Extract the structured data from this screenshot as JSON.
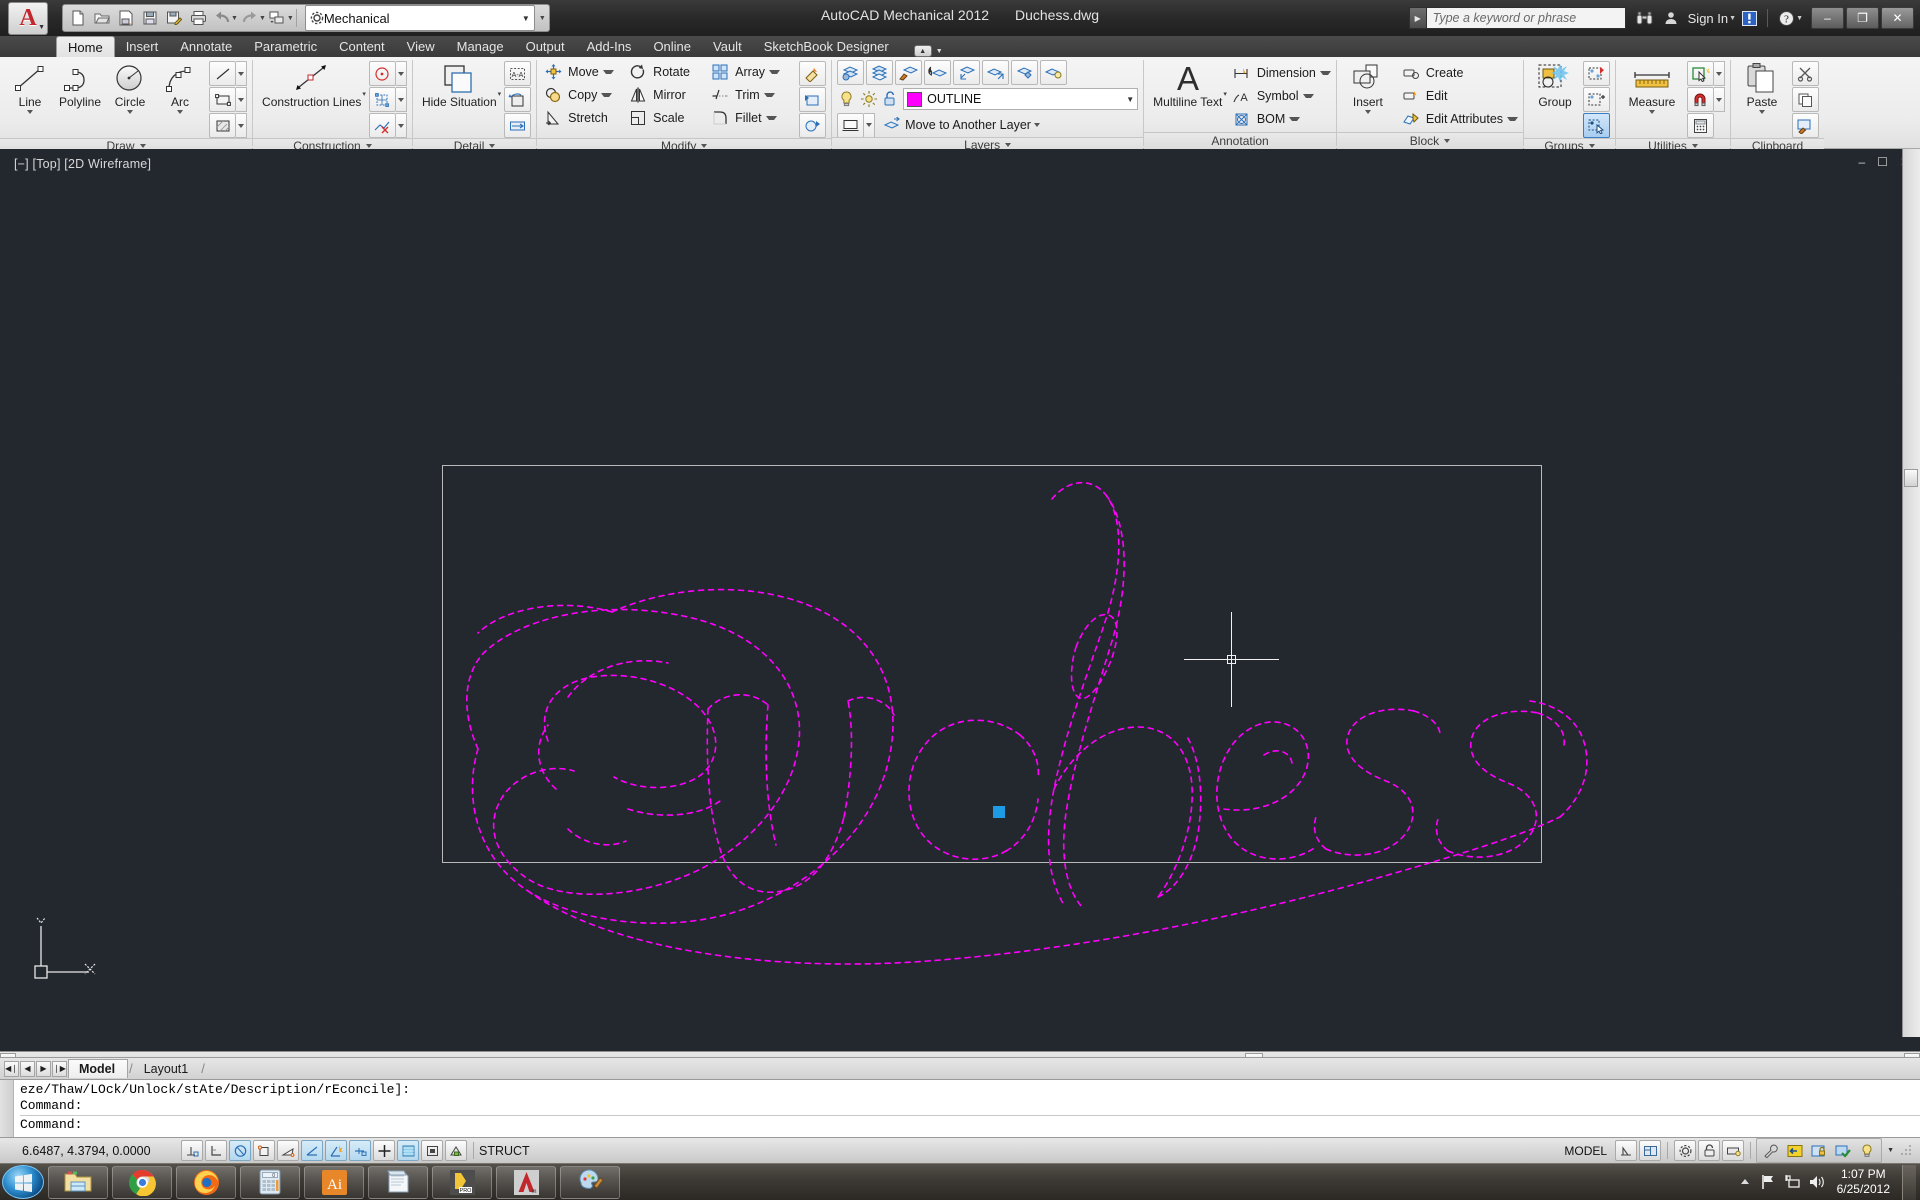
{
  "titlebar": {
    "app_logo": "autocad-logo",
    "workspace": "Mechanical",
    "app_title": "AutoCAD Mechanical 2012",
    "document": "Duchess.dwg",
    "search_placeholder": "Type a keyword or phrase",
    "sign_in": "Sign In",
    "quick_access": [
      {
        "name": "new-file",
        "icon": "page-icon"
      },
      {
        "name": "open-file",
        "icon": "folder-open-icon"
      },
      {
        "name": "save-as-dwg",
        "icon": "save-dwg-icon"
      },
      {
        "name": "save",
        "icon": "floppy-icon"
      },
      {
        "name": "save-edit",
        "icon": "floppy-pencil-icon"
      },
      {
        "name": "plot",
        "icon": "printer-icon"
      },
      {
        "name": "undo",
        "icon": "undo-arrow-icon"
      },
      {
        "name": "redo",
        "icon": "redo-arrow-icon"
      },
      {
        "name": "batch-plot",
        "icon": "stacked-pages-icon"
      }
    ],
    "window_buttons": {
      "minimize": "–",
      "maximize": "❐",
      "close": "✕"
    }
  },
  "tabs": [
    {
      "label": "Home",
      "active": true
    },
    {
      "label": "Insert",
      "active": false
    },
    {
      "label": "Annotate",
      "active": false
    },
    {
      "label": "Parametric",
      "active": false
    },
    {
      "label": "Content",
      "active": false
    },
    {
      "label": "View",
      "active": false
    },
    {
      "label": "Manage",
      "active": false
    },
    {
      "label": "Output",
      "active": false
    },
    {
      "label": "Add-Ins",
      "active": false
    },
    {
      "label": "Online",
      "active": false
    },
    {
      "label": "Vault",
      "active": false
    },
    {
      "label": "SketchBook Designer",
      "active": false
    }
  ],
  "ribbon": {
    "draw": {
      "title": "Draw",
      "big": [
        {
          "label": "Line",
          "icon": "line-icon",
          "dropdown": true
        },
        {
          "label": "Polyline",
          "icon": "polyline-icon",
          "dropdown": false
        },
        {
          "label": "Circle",
          "icon": "circle-icon",
          "dropdown": true
        },
        {
          "label": "Arc",
          "icon": "arc-icon",
          "dropdown": true
        }
      ],
      "small": [
        {
          "name": "construction-line-small",
          "icon": "diagonal-line-icon"
        },
        {
          "name": "rectangle",
          "icon": "rectangle-icon"
        },
        {
          "name": "hatch",
          "icon": "hatch-icon"
        }
      ]
    },
    "construction": {
      "title": "Construction",
      "big": [
        {
          "label": "Construction Lines",
          "icon": "double-arrow-icon",
          "dropdown": true
        }
      ],
      "small": [
        {
          "name": "construction-circle",
          "icon": "red-circle-icon"
        },
        {
          "name": "construction-grid",
          "icon": "blue-grid-icon"
        },
        {
          "name": "delete-construction",
          "icon": "delete-construction-icon"
        }
      ]
    },
    "detail": {
      "title": "Detail",
      "big": [
        {
          "label": "Hide Situation",
          "icon": "hide-situation-icon",
          "dropdown": true
        }
      ],
      "small": [
        {
          "name": "detail-view",
          "icon": "detail-frame-icon"
        },
        {
          "name": "edit-situation",
          "icon": "edit-situation-icon"
        },
        {
          "name": "swap-situation",
          "icon": "swap-situation-icon"
        }
      ]
    },
    "modify": {
      "title": "Modify",
      "rows": [
        [
          {
            "label": "Move",
            "icon": "move-icon",
            "dropdown": true
          },
          {
            "label": "Rotate",
            "icon": "rotate-icon",
            "dropdown": false
          },
          {
            "label": "Array",
            "icon": "array-icon",
            "dropdown": true
          }
        ],
        [
          {
            "label": "Copy",
            "icon": "copy-icon",
            "dropdown": true
          },
          {
            "label": "Mirror",
            "icon": "mirror-icon",
            "dropdown": false
          },
          {
            "label": "Trim",
            "icon": "trim-icon",
            "dropdown": true
          }
        ],
        [
          {
            "label": "Stretch",
            "icon": "stretch-icon",
            "dropdown": false
          },
          {
            "label": "Scale",
            "icon": "scale-icon",
            "dropdown": false
          },
          {
            "label": "Fillet",
            "icon": "fillet-icon",
            "dropdown": true
          }
        ]
      ],
      "extra": [
        {
          "name": "power-erase",
          "icon": "power-erase-icon"
        },
        {
          "name": "power-recreate",
          "icon": "power-recreate-icon"
        },
        {
          "name": "power-copy",
          "icon": "power-copy-icon"
        }
      ]
    },
    "layers": {
      "title": "Layers",
      "current_layer": "OUTLINE",
      "layer_color": "#ff00ff",
      "move_to_another_layer": "Move to Another Layer",
      "toprow": [
        {
          "name": "layer-properties",
          "icon": "layer-gear-icon"
        },
        {
          "name": "layer-stack",
          "icon": "layer-stack-icon"
        },
        {
          "name": "layer-match",
          "icon": "layer-brush-icon"
        },
        {
          "name": "layer-previous",
          "icon": "layer-previous-icon"
        },
        {
          "name": "layer-make-current",
          "icon": "layer-down-icon"
        },
        {
          "name": "layer-set-current",
          "icon": "layer-up-icon"
        },
        {
          "name": "layer-isolate",
          "icon": "layer-isolate-icon"
        },
        {
          "name": "layer-off",
          "icon": "layer-off-icon"
        }
      ],
      "state_icons": [
        {
          "name": "layer-on-bulb",
          "icon": "lightbulb-icon"
        },
        {
          "name": "layer-freeze-sun",
          "icon": "sun-icon"
        },
        {
          "name": "layer-unlock",
          "icon": "unlock-icon"
        }
      ]
    },
    "annotation": {
      "title": "Annotation",
      "big": [
        {
          "label": "Multiline Text",
          "icon": "text-A-icon",
          "dropdown": true
        }
      ],
      "rows": [
        {
          "label": "Dimension",
          "icon": "dimension-icon",
          "dropdown": true
        },
        {
          "label": "Symbol",
          "icon": "symbol-icon",
          "dropdown": true
        },
        {
          "label": "BOM",
          "icon": "bom-icon",
          "dropdown": true
        }
      ]
    },
    "block": {
      "title": "Block",
      "big": [
        {
          "label": "Insert",
          "icon": "insert-block-icon",
          "dropdown": true
        }
      ],
      "rows": [
        {
          "label": "Create",
          "icon": "create-block-icon",
          "dropdown": false
        },
        {
          "label": "Edit",
          "icon": "edit-block-icon",
          "dropdown": false
        },
        {
          "label": "Edit Attributes",
          "icon": "edit-attributes-icon",
          "dropdown": true
        }
      ]
    },
    "groups": {
      "title": "Groups",
      "big": [
        {
          "label": "Group",
          "icon": "group-icon",
          "dropdown": false
        }
      ],
      "small": [
        {
          "name": "ungroup",
          "icon": "ungroup-icon"
        },
        {
          "name": "group-edit",
          "icon": "group-edit-icon"
        },
        {
          "name": "group-selection-toggle",
          "icon": "group-selection-icon",
          "selected": true
        }
      ]
    },
    "utilities": {
      "title": "Utilities",
      "big": [
        {
          "label": "Measure",
          "icon": "ruler-icon",
          "dropdown": true
        }
      ],
      "small": [
        {
          "name": "quick-select",
          "icon": "quick-select-icon"
        },
        {
          "name": "object-snap",
          "icon": "magnet-icon"
        },
        {
          "name": "calculator",
          "icon": "calculator-icon"
        }
      ]
    },
    "clipboard": {
      "title": "Clipboard",
      "big": [
        {
          "label": "Paste",
          "icon": "paste-icon",
          "dropdown": true
        }
      ],
      "small": [
        {
          "name": "cut",
          "icon": "scissors-icon"
        },
        {
          "name": "copy-clip",
          "icon": "copy-pages-icon"
        },
        {
          "name": "match-properties",
          "icon": "match-properties-icon"
        }
      ]
    }
  },
  "viewport": {
    "label": "[−] [Top] [2D Wireframe]",
    "background": "#23282f",
    "drawing_color": "#ff00ff",
    "border_color": "#b9b9b9",
    "grip_color": "#1e9be5",
    "ucs": {
      "x_label": "X",
      "y_label": "Y"
    },
    "artwork_text": "Duchess"
  },
  "layout_tabs": {
    "nav": [
      "◀❘",
      "◀",
      "▶",
      "❘▶"
    ],
    "tabs": [
      {
        "label": "Model",
        "active": true
      },
      {
        "label": "Layout1",
        "active": false
      }
    ]
  },
  "command_line": {
    "line1": "eze/Thaw/LOck/Unlock/stAte/Description/rEconcile]:",
    "line2": "Command:",
    "line3": "Command:"
  },
  "status_bar": {
    "coordinates": "6.6487, 4.3794, 0.0000",
    "struct_label": "STRUCT",
    "model_label": "MODEL",
    "toggles": [
      {
        "name": "infer-constraints",
        "icon": "infer-icon",
        "on": false
      },
      {
        "name": "snap-mode",
        "icon": "snap-grid-icon",
        "on": false
      },
      {
        "name": "grid-display",
        "icon": "grid-icon",
        "on": true
      },
      {
        "name": "ortho-mode",
        "icon": "ortho-icon",
        "on": false
      },
      {
        "name": "polar-tracking",
        "icon": "polar-icon",
        "on": false
      },
      {
        "name": "object-snap",
        "icon": "osnap-icon",
        "on": true
      },
      {
        "name": "3d-object-snap",
        "icon": "osnap3d-icon",
        "on": true
      },
      {
        "name": "object-snap-tracking",
        "icon": "otrack-icon",
        "on": true
      },
      {
        "name": "dynamic-ucs",
        "icon": "ducs-icon",
        "on": false
      },
      {
        "name": "dynamic-input",
        "icon": "dyn-input-icon",
        "on": true
      },
      {
        "name": "lineweight",
        "icon": "lineweight-icon",
        "on": false
      },
      {
        "name": "transparency",
        "icon": "transparency-icon",
        "on": false
      },
      {
        "name": "quick-properties",
        "icon": "quick-props-icon",
        "on": false
      },
      {
        "name": "selection-cycling",
        "icon": "selection-cycling-icon",
        "on": false
      }
    ],
    "right_icons": [
      {
        "name": "annotation-scale",
        "icon": "annotation-scale-icon"
      },
      {
        "name": "workspace-switch",
        "icon": "workspace-icon"
      },
      {
        "name": "toolbar-lock",
        "icon": "padlock-icon"
      },
      {
        "name": "hardware-accel",
        "icon": "hardware-icon"
      },
      {
        "name": "customization",
        "icon": "wrench-icon"
      },
      {
        "name": "isolate-objects",
        "icon": "isolate-icon"
      },
      {
        "name": "secure-load",
        "icon": "secure-icon"
      },
      {
        "name": "drawing-status",
        "icon": "drawing-status-icon"
      },
      {
        "name": "clean-screen",
        "icon": "bulb-icon"
      }
    ]
  },
  "taskbar": {
    "start": "windows-orb",
    "items": [
      {
        "name": "windows-explorer",
        "icon": "folder-icon"
      },
      {
        "name": "google-chrome",
        "icon": "chrome-icon"
      },
      {
        "name": "mozilla-firefox",
        "icon": "firefox-icon"
      },
      {
        "name": "calculator",
        "icon": "calculator-icon"
      },
      {
        "name": "adobe-illustrator",
        "icon": "illustrator-icon",
        "label": "Ai"
      },
      {
        "name": "notepad",
        "icon": "notepad-icon"
      },
      {
        "name": "pro-engineer",
        "icon": "proe-icon",
        "label": "PRO"
      },
      {
        "name": "autocad-mechanical",
        "icon": "autocad-icon",
        "label": "A"
      },
      {
        "name": "paint",
        "icon": "paint-icon"
      }
    ],
    "tray": [
      {
        "name": "show-hidden-icons",
        "icon": "chevron-up-icon"
      },
      {
        "name": "action-center-flag",
        "icon": "flag-icon"
      },
      {
        "name": "network",
        "icon": "network-icon"
      },
      {
        "name": "volume",
        "icon": "speaker-icon"
      }
    ],
    "clock_time": "1:07 PM",
    "clock_date": "6/25/2012"
  }
}
